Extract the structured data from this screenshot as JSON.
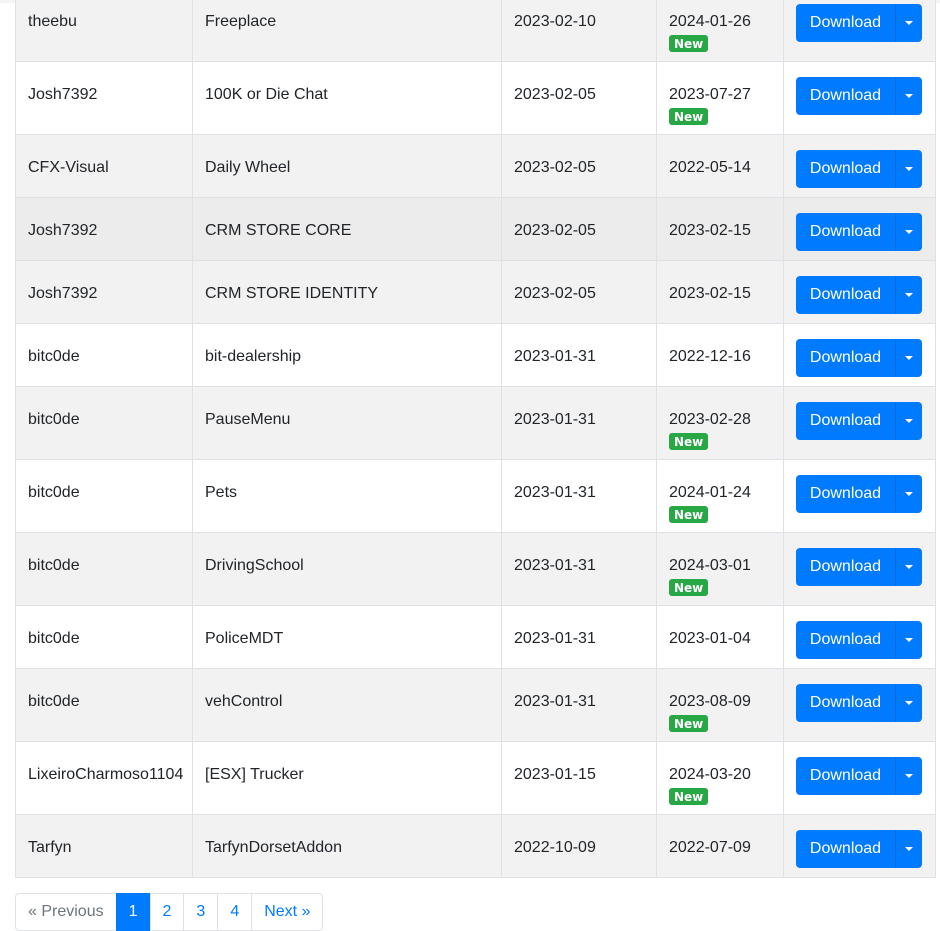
{
  "rows": [
    {
      "author": "theebu",
      "name": "Freeplace",
      "created": "2023-02-10",
      "updated": "2024-01-26",
      "badge": "New"
    },
    {
      "author": "Josh7392",
      "name": "100K or Die Chat",
      "created": "2023-02-05",
      "updated": "2023-07-27",
      "badge": "New"
    },
    {
      "author": "CFX-Visual",
      "name": "Daily Wheel",
      "created": "2023-02-05",
      "updated": "2022-05-14",
      "badge": ""
    },
    {
      "author": "Josh7392",
      "name": "CRM STORE CORE",
      "created": "2023-02-05",
      "updated": "2023-02-15",
      "badge": ""
    },
    {
      "author": "Josh7392",
      "name": "CRM STORE IDENTITY",
      "created": "2023-02-05",
      "updated": "2023-02-15",
      "badge": ""
    },
    {
      "author": "bitc0de",
      "name": "bit-dealership",
      "created": "2023-01-31",
      "updated": "2022-12-16",
      "badge": ""
    },
    {
      "author": "bitc0de",
      "name": "PauseMenu",
      "created": "2023-01-31",
      "updated": "2023-02-28",
      "badge": "New"
    },
    {
      "author": "bitc0de",
      "name": "Pets",
      "created": "2023-01-31",
      "updated": "2024-01-24",
      "badge": "New"
    },
    {
      "author": "bitc0de",
      "name": "DrivingSchool",
      "created": "2023-01-31",
      "updated": "2024-03-01",
      "badge": "New"
    },
    {
      "author": "bitc0de",
      "name": "PoliceMDT",
      "created": "2023-01-31",
      "updated": "2023-01-04",
      "badge": ""
    },
    {
      "author": "bitc0de",
      "name": "vehControl",
      "created": "2023-01-31",
      "updated": "2023-08-09",
      "badge": "New"
    },
    {
      "author": "LixeiroCharmoso1104",
      "name": "[ESX] Trucker",
      "created": "2023-01-15",
      "updated": "2024-03-20",
      "badge": "New"
    },
    {
      "author": "Tarfyn",
      "name": "TarfynDorsetAddon",
      "created": "2022-10-09",
      "updated": "2022-07-09",
      "badge": ""
    }
  ],
  "download_label": "Download",
  "pagination": {
    "previous": "« Previous",
    "pages": [
      "1",
      "2",
      "3",
      "4"
    ],
    "active_page": "1",
    "next": "Next »"
  },
  "colors": {
    "primary": "#007bff",
    "badge_success": "#28a745",
    "row_stripe": "#f2f2f2"
  }
}
